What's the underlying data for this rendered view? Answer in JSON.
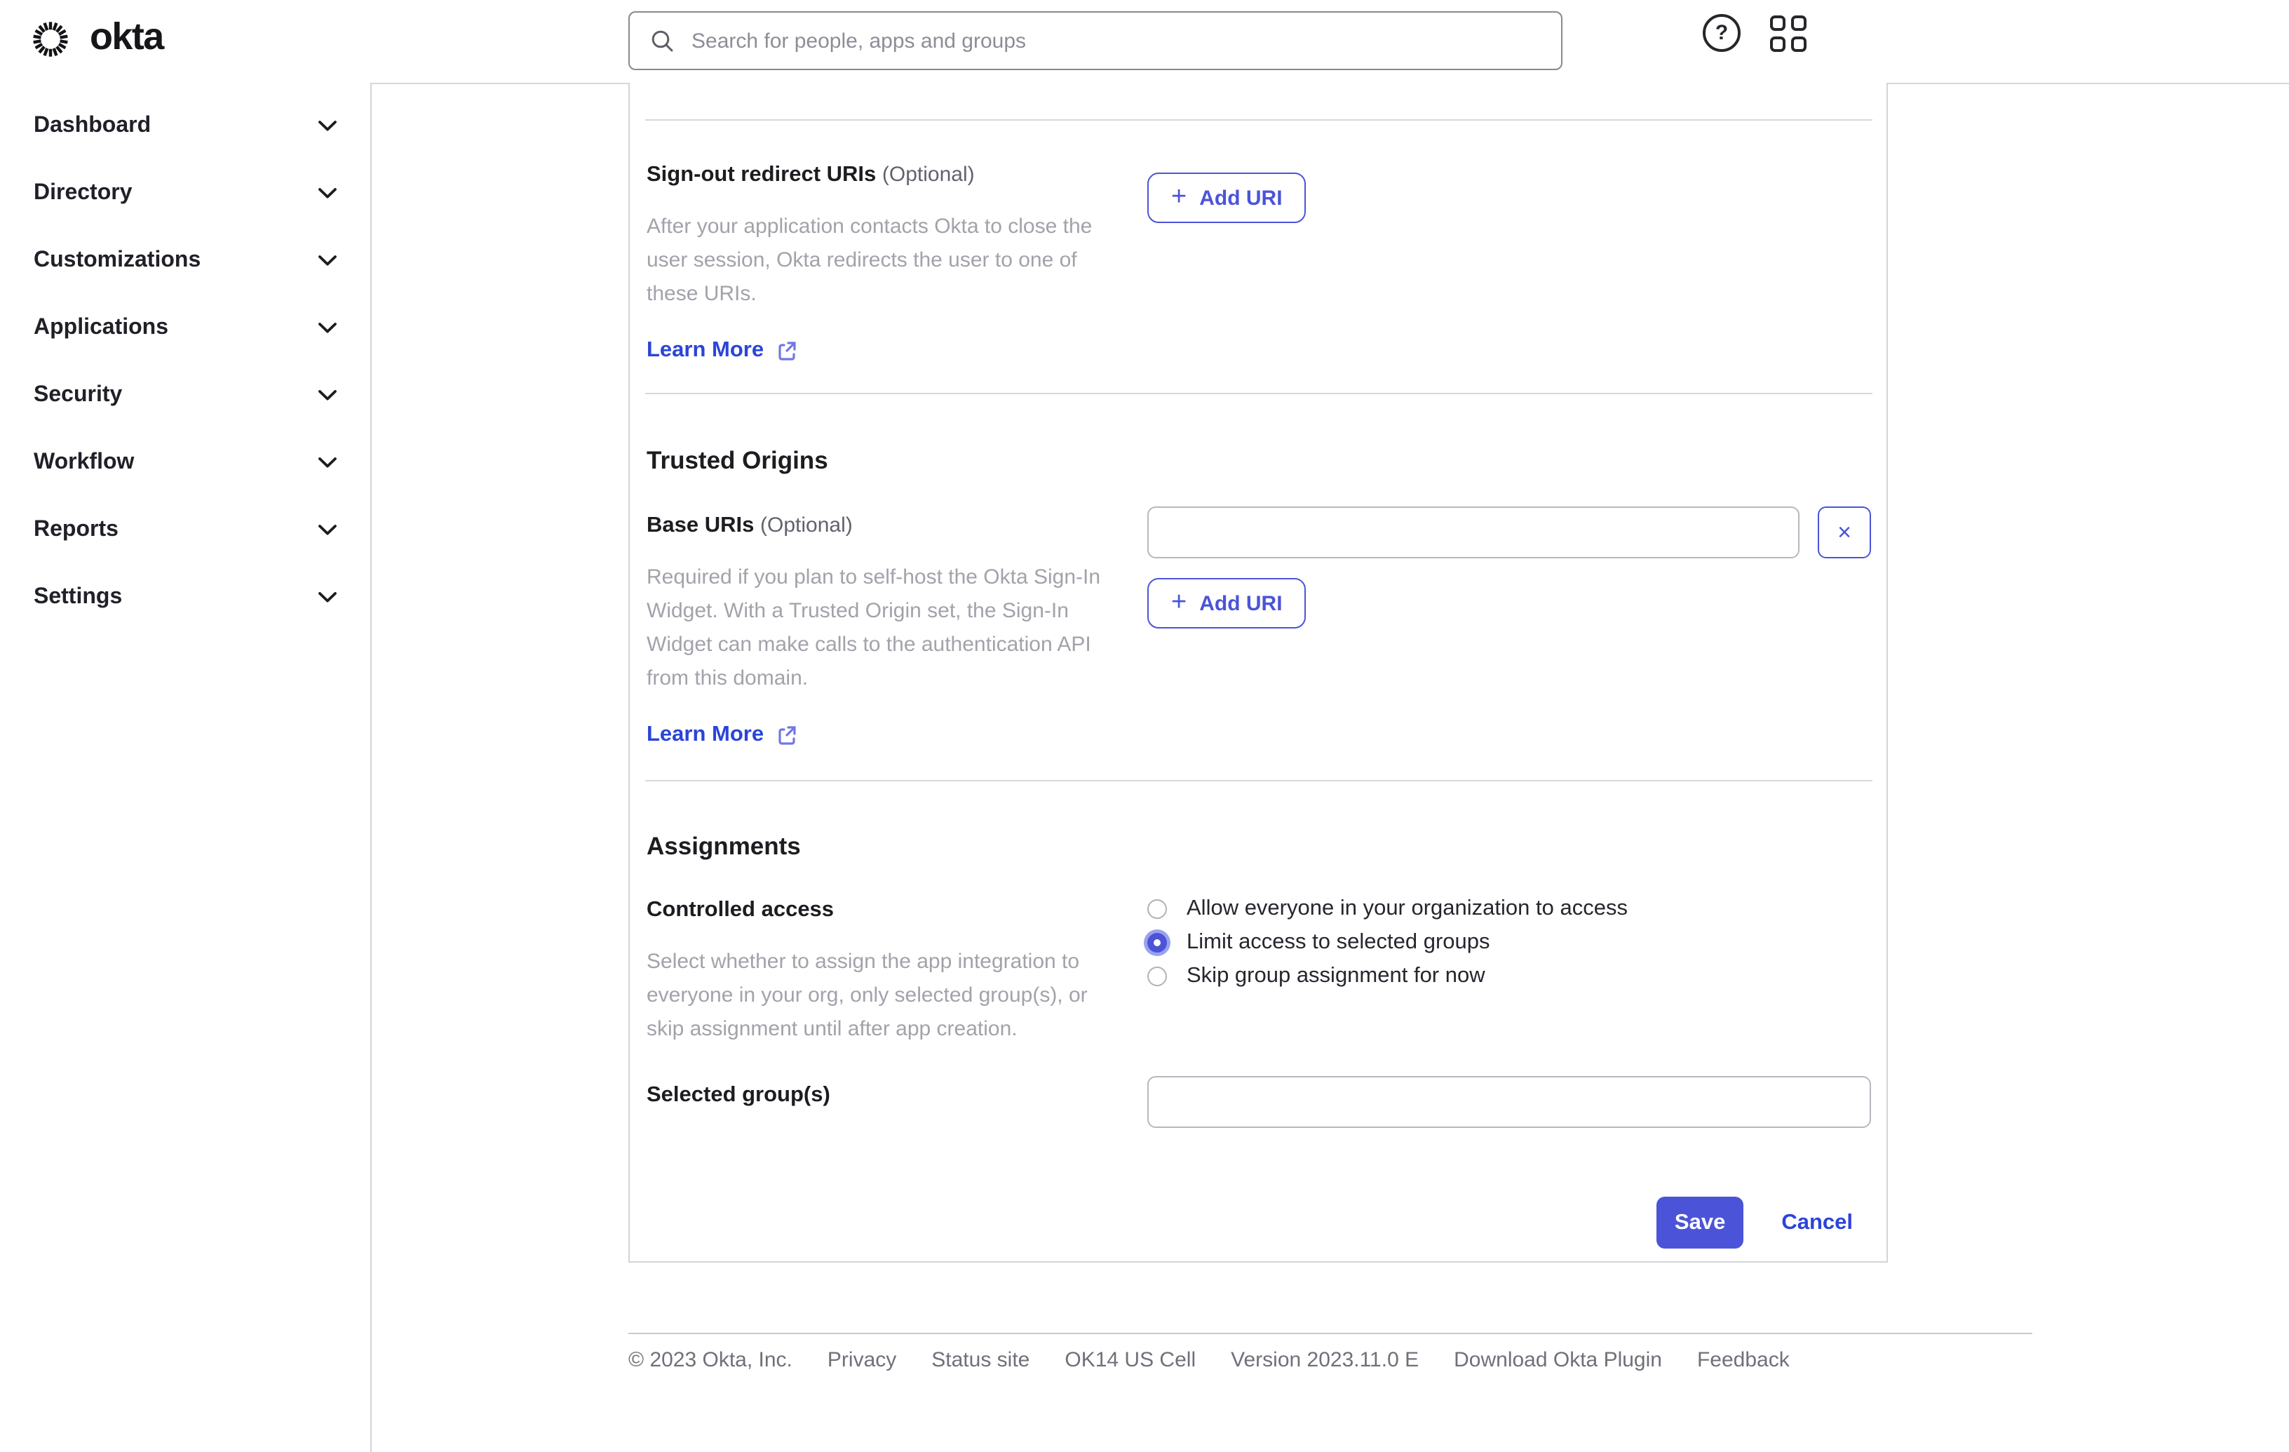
{
  "colors": {
    "accent": "#4b54d8",
    "accent_ring": "#9aa2ee",
    "link": "#2b44d8",
    "text": "#1c1c21",
    "muted_description": "#a2a2ab",
    "optional_gray": "#62626c",
    "footer_gray": "#70707a",
    "border_gray": "#d8d8dd"
  },
  "header": {
    "brand": "okta",
    "search": {
      "placeholder": "Search for people, apps and groups",
      "value": ""
    },
    "help_icon_glyph": "?"
  },
  "sidebar": {
    "items": [
      {
        "label": "Dashboard"
      },
      {
        "label": "Directory"
      },
      {
        "label": "Customizations"
      },
      {
        "label": "Applications"
      },
      {
        "label": "Security"
      },
      {
        "label": "Workflow"
      },
      {
        "label": "Reports"
      },
      {
        "label": "Settings"
      }
    ]
  },
  "main": {
    "signout": {
      "label": "Sign-out redirect URIs",
      "optional": "(Optional)",
      "description": "After your application contacts Okta to close the user session, Okta redirects the user to one of these URIs.",
      "learn_more": "Learn More",
      "plus": "+",
      "add_uri_label": "Add URI"
    },
    "trusted_origins": {
      "heading": "Trusted Origins",
      "base_uris_label": "Base URIs",
      "optional": "(Optional)",
      "input_value": "",
      "remove_label": "×",
      "description": "Required if you plan to self-host the Okta Sign-In Widget. With a Trusted Origin set, the Sign-In Widget can make calls to the authentication API from this domain.",
      "learn_more": "Learn More",
      "plus": "+",
      "add_uri_label": "Add URI"
    },
    "assignments": {
      "heading": "Assignments",
      "controlled_access_label": "Controlled access",
      "description": "Select whether to assign the app integration to everyone in your org, only selected group(s), or skip assignment until after app creation.",
      "options": [
        {
          "label": "Allow everyone in your organization to access",
          "selected": false
        },
        {
          "label": "Limit access to selected groups",
          "selected": true
        },
        {
          "label": "Skip group assignment for now",
          "selected": false
        }
      ],
      "selected_groups_label": "Selected group(s)",
      "selected_groups_value": ""
    },
    "actions": {
      "save": "Save",
      "cancel": "Cancel"
    }
  },
  "footer": {
    "copyright": "© 2023 Okta, Inc.",
    "links": [
      {
        "label": "Privacy"
      },
      {
        "label": "Status site"
      },
      {
        "label": "OK14 US Cell"
      },
      {
        "label": "Version 2023.11.0 E"
      },
      {
        "label": "Download Okta Plugin"
      },
      {
        "label": "Feedback"
      }
    ]
  }
}
